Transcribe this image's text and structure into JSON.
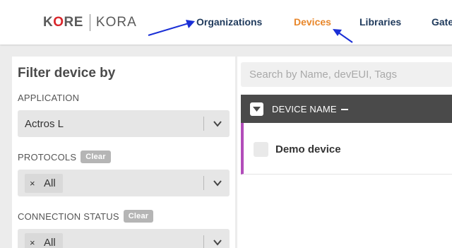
{
  "brand": {
    "logo_primary": "KORE",
    "logo_secondary": "KORA",
    "accent_color": "#d9262b"
  },
  "nav": {
    "items": [
      {
        "label": "Organizations",
        "active": false
      },
      {
        "label": "Devices",
        "active": true
      },
      {
        "label": "Libraries",
        "active": false
      },
      {
        "label": "Gate",
        "active": false
      }
    ],
    "active_color": "#e8872b"
  },
  "filter": {
    "title": "Filter device by",
    "application": {
      "label": "APPLICATION",
      "value": "Actros L"
    },
    "protocols": {
      "label": "PROTOCOLS",
      "clear_label": "Clear",
      "tag": "All",
      "tag_remove": "×"
    },
    "connection_status": {
      "label": "CONNECTION STATUS",
      "clear_label": "Clear",
      "tag": "All",
      "tag_remove": "×"
    }
  },
  "search": {
    "placeholder": "Search by Name, devEUI, Tags"
  },
  "table": {
    "columns": [
      "DEVICE NAME"
    ],
    "rows": [
      {
        "name": "Demo device",
        "accent": "#b24dba"
      }
    ]
  },
  "annotations": {
    "arrow_color": "#1a2fd6",
    "count": 2
  }
}
